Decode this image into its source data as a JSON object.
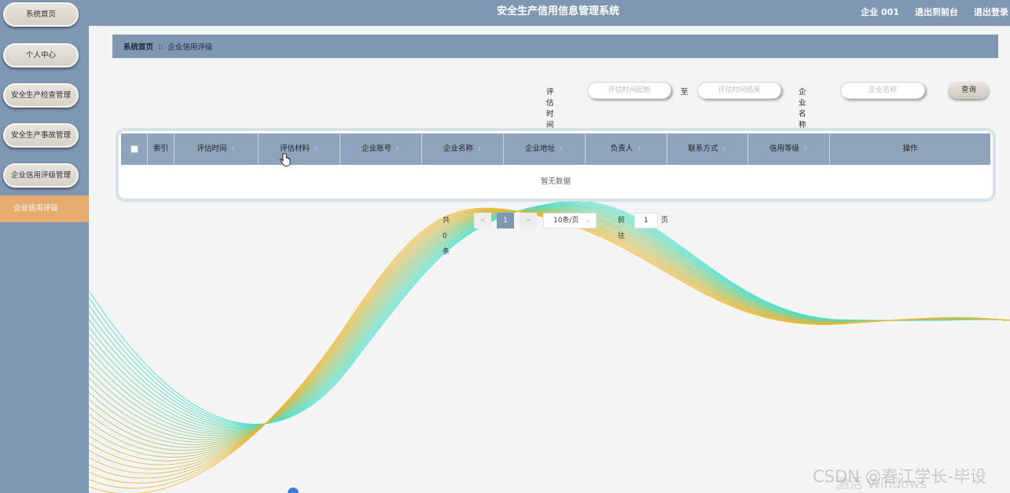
{
  "header": {
    "title": "安全生产信用信息管理系统",
    "user": "企业 001",
    "back_to_front": "退出到前台",
    "logout": "退出登录"
  },
  "sidebar": {
    "items": [
      {
        "label": "系统首页"
      },
      {
        "label": "个人中心"
      },
      {
        "label": "安全生产检查管理"
      },
      {
        "label": "安全生产事故管理"
      },
      {
        "label": "企业信用评级管理"
      }
    ],
    "active_sub": "企业信用评级"
  },
  "breadcrumb": {
    "home": "系统首页",
    "separator": "::",
    "current": "企业信用评级"
  },
  "search": {
    "time_label": "评估时间",
    "start_placeholder": "评估时间起始",
    "to_label": "至",
    "end_placeholder": "评估时间结束",
    "company_label": "企业名称",
    "company_placeholder": "企业名称",
    "query_button": "查询"
  },
  "table": {
    "columns": [
      "索引",
      "评估时间",
      "评估材料",
      "企业账号",
      "企业名称",
      "企业地址",
      "负责人",
      "联系方式",
      "信用等级",
      "操作"
    ],
    "sortable": [
      false,
      true,
      true,
      true,
      true,
      true,
      true,
      true,
      true,
      false
    ],
    "empty_text": "暂无数据"
  },
  "pagination": {
    "total": "共 0 条",
    "prev": "<",
    "page": "1",
    "next": ">",
    "page_size": "10条/页",
    "goto_label": "前往",
    "goto_value": "1",
    "page_unit": "页"
  },
  "watermark": {
    "text": "CSDN @春江学长-毕设",
    "activate": "激活 Windows"
  },
  "colors": {
    "primary": "#7f97b3",
    "accent": "#e7aa6f",
    "table_header": "#8ea4bd",
    "wave_teal": "#3de0d0",
    "wave_orange": "#f2b32a"
  }
}
